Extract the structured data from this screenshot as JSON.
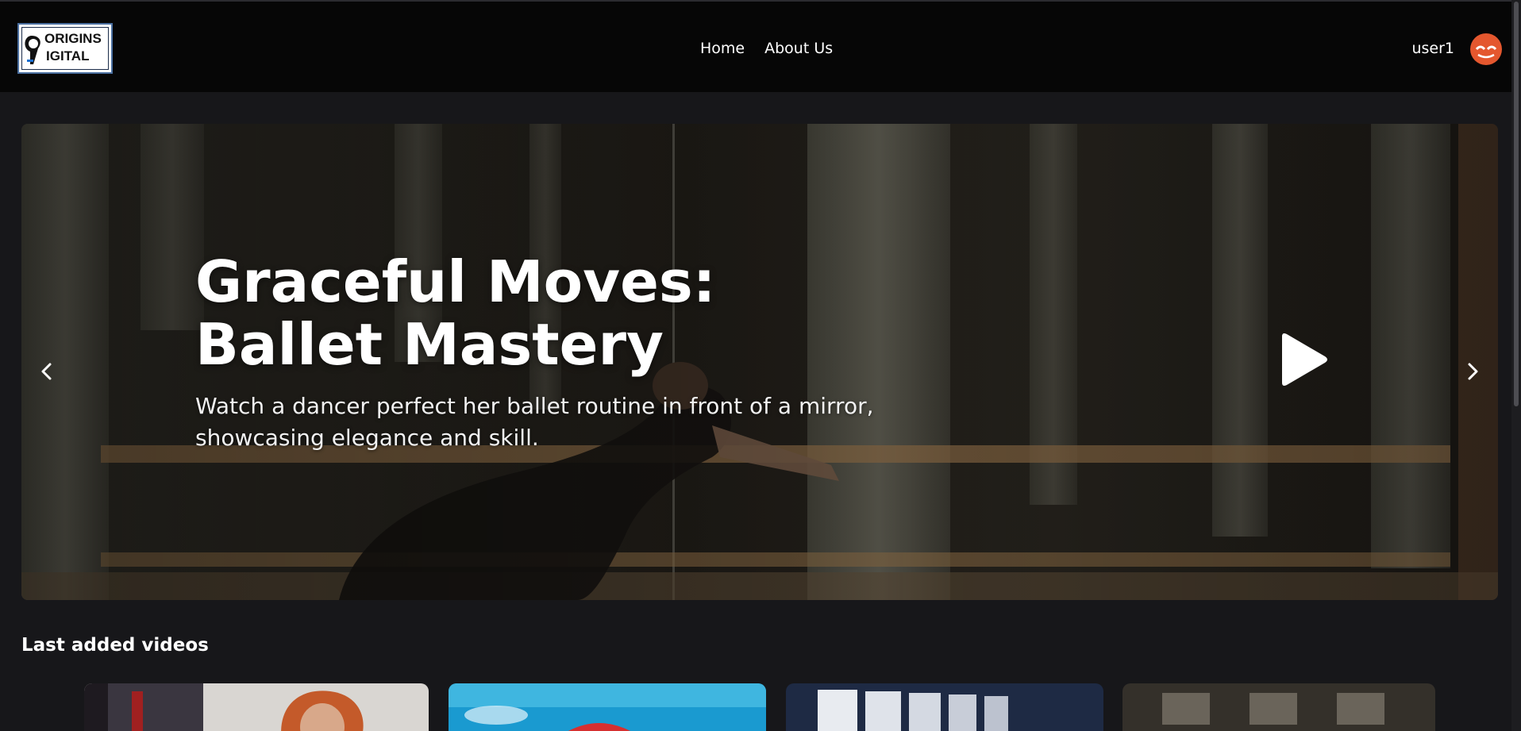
{
  "header": {
    "logo_text_line1": "ORIGINS",
    "logo_text_line2": "IGITAL",
    "nav": [
      {
        "label": "Home"
      },
      {
        "label": "About Us"
      }
    ],
    "username": "user1"
  },
  "hero": {
    "title": "Graceful Moves: Ballet Mastery",
    "description": "Watch a dancer perfect her ballet routine in front of a mirror, showcasing elegance and skill.",
    "prev_icon": "chevron-left-icon",
    "next_icon": "chevron-right-icon",
    "play_icon": "play-icon"
  },
  "sections": {
    "last_added_title": "Last added videos"
  },
  "colors": {
    "background": "#17171a",
    "topbar": "#060606",
    "avatar": "#e4572e",
    "text": "#ffffff"
  }
}
